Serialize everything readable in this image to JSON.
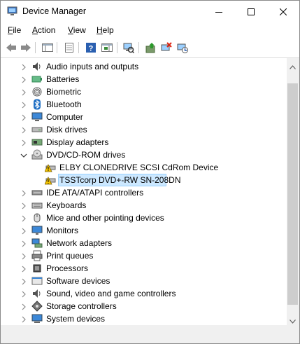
{
  "window": {
    "title": "Device Manager"
  },
  "menu": {
    "file_accel": "F",
    "file_rest": "ile",
    "action_accel": "A",
    "action_rest": "ction",
    "view_accel": "V",
    "view_rest": "iew",
    "help_accel": "H",
    "help_rest": "elp"
  },
  "tree": {
    "items": [
      {
        "label": "Audio inputs and outputs",
        "icon": "speaker-icon"
      },
      {
        "label": "Batteries",
        "icon": "battery-icon"
      },
      {
        "label": "Biometric",
        "icon": "fingerprint-icon"
      },
      {
        "label": "Bluetooth",
        "icon": "bluetooth-icon"
      },
      {
        "label": "Computer",
        "icon": "computer-icon"
      },
      {
        "label": "Disk drives",
        "icon": "disk-drive-icon"
      },
      {
        "label": "Display adapters",
        "icon": "display-adapter-icon"
      },
      {
        "label": "DVD/CD-ROM drives",
        "icon": "dvd-drive-icon",
        "expanded": true
      },
      {
        "label": "ELBY CLONEDRIVE SCSI CdRom Device",
        "icon": "warning-dvd-icon",
        "child": true
      },
      {
        "label": "TSSTcorp DVD+-RW SN-208DN",
        "icon": "warning-dvd-icon",
        "child": true,
        "selected": true
      },
      {
        "label": "IDE ATA/ATAPI controllers",
        "icon": "ide-controller-icon"
      },
      {
        "label": "Keyboards",
        "icon": "keyboard-icon"
      },
      {
        "label": "Mice and other pointing devices",
        "icon": "mouse-icon"
      },
      {
        "label": "Monitors",
        "icon": "monitor-icon"
      },
      {
        "label": "Network adapters",
        "icon": "network-adapter-icon"
      },
      {
        "label": "Print queues",
        "icon": "printer-icon"
      },
      {
        "label": "Processors",
        "icon": "processor-icon"
      },
      {
        "label": "Software devices",
        "icon": "software-device-icon"
      },
      {
        "label": "Sound, video and game controllers",
        "icon": "sound-controller-icon"
      },
      {
        "label": "Storage controllers",
        "icon": "storage-controller-icon"
      },
      {
        "label": "System devices",
        "icon": "system-device-icon"
      }
    ]
  },
  "colors": {
    "selection_bg": "#cce8ff",
    "selection_border": "#99d1ff",
    "warning": "#f5c400",
    "accent_blue": "#1f6fc4"
  }
}
